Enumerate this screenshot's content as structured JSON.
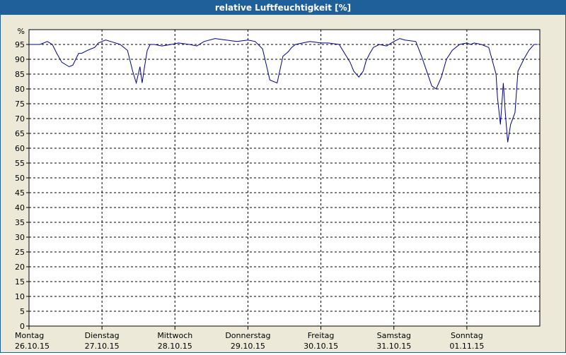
{
  "window": {
    "title": "relative Luftfeuchtigkeit [%]"
  },
  "chart_data": {
    "type": "line",
    "title": "relative Luftfeuchtigkeit [%]",
    "ylabel": "%",
    "xlabel": "",
    "ylim": [
      0,
      100
    ],
    "xlim": [
      0,
      7
    ],
    "grid": true,
    "line_color": "#00008b",
    "grid_color": "#000000",
    "yticks": [
      "0",
      "5",
      "10",
      "15",
      "20",
      "25",
      "30",
      "35",
      "40",
      "45",
      "50",
      "55",
      "60",
      "65",
      "70",
      "75",
      "80",
      "85",
      "90",
      "95"
    ],
    "xticks": [
      {
        "day": "Montag",
        "date": "26.10.15"
      },
      {
        "day": "Dienstag",
        "date": "27.10.15"
      },
      {
        "day": "Mittwoch",
        "date": "28.10.15"
      },
      {
        "day": "Donnerstag",
        "date": "29.10.15"
      },
      {
        "day": "Freitag",
        "date": "30.10.15"
      },
      {
        "day": "Samstag",
        "date": "31.10.15"
      },
      {
        "day": "Sonntag",
        "date": "01.11.15"
      }
    ],
    "series": [
      {
        "x": [
          0.0,
          0.05,
          0.15,
          0.25,
          0.32,
          0.38,
          0.45,
          0.55,
          0.6,
          0.68,
          0.72,
          0.8,
          0.9,
          0.95,
          1.0,
          1.05,
          1.12,
          1.25,
          1.35,
          1.42,
          1.47,
          1.52,
          1.55,
          1.58,
          1.62,
          1.66,
          1.72,
          1.82,
          1.95,
          2.05,
          2.2,
          2.3,
          2.4,
          2.55,
          2.7,
          2.85,
          3.0,
          3.1,
          3.2,
          3.3,
          3.4,
          3.48,
          3.55,
          3.6,
          3.65,
          3.75,
          3.85,
          4.0,
          4.1,
          4.25,
          4.4,
          4.45,
          4.52,
          4.58,
          4.62,
          4.67,
          4.72,
          4.8,
          4.9,
          5.0,
          5.08,
          5.15,
          5.3,
          5.38,
          5.45,
          5.52,
          5.58,
          5.65,
          5.72,
          5.8,
          5.9,
          6.0,
          6.05,
          6.1,
          6.2,
          6.3,
          6.4,
          6.42,
          6.46,
          6.5,
          6.53,
          6.56,
          6.6,
          6.66,
          6.7,
          6.78,
          6.85,
          6.92,
          6.97
        ],
        "y": [
          95,
          95,
          95,
          96,
          95,
          92,
          89,
          87.5,
          88,
          92,
          92,
          93,
          94,
          95.5,
          96,
          96.5,
          96,
          95,
          93,
          86,
          82,
          87.5,
          82,
          87,
          93,
          95,
          95,
          94.5,
          95,
          95.5,
          95,
          94.5,
          96,
          97,
          96.5,
          96,
          96.5,
          96,
          93.5,
          83,
          82,
          91,
          92.5,
          94,
          95,
          95.5,
          96,
          95.5,
          95.5,
          95,
          89,
          86,
          84,
          86,
          89.5,
          92,
          94,
          95,
          94.5,
          96,
          97,
          96.5,
          96,
          91,
          86,
          81,
          80,
          84,
          90,
          93,
          95,
          95.5,
          95,
          95.5,
          95,
          94,
          85,
          77,
          68,
          82,
          71,
          62,
          68,
          72,
          86,
          90,
          93,
          95,
          95
        ]
      }
    ]
  }
}
